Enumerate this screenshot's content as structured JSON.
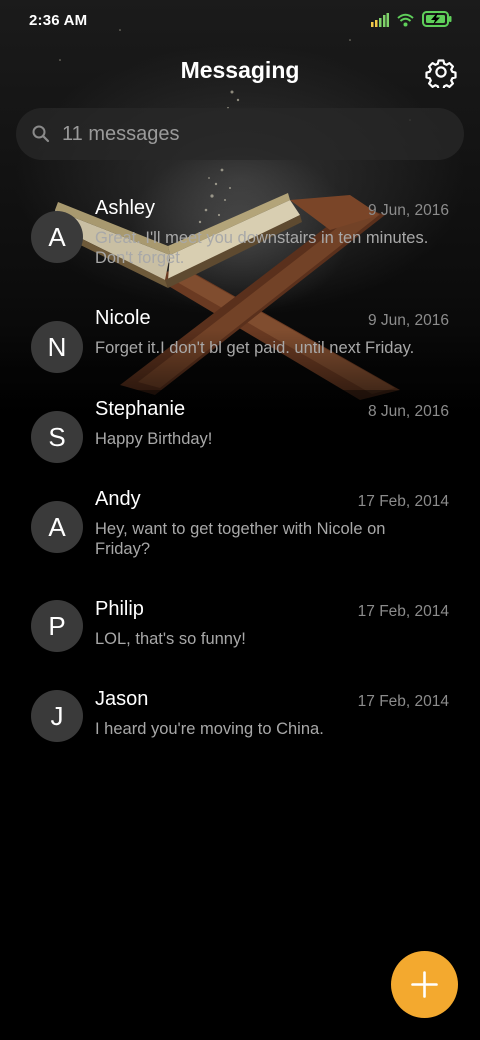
{
  "status_bar": {
    "time": "2:36 AM",
    "icons": [
      "signal-icon",
      "wifi-icon",
      "battery-charging-icon"
    ]
  },
  "header": {
    "title": "Messaging",
    "settings_icon": "gear-icon"
  },
  "search": {
    "placeholder": "11 messages",
    "icon": "search-icon"
  },
  "conversations": [
    {
      "initial": "A",
      "name": "Ashley",
      "date": "9 Jun, 2016",
      "snippet": "Great. I'll meet you downstairs in ten minutes. Don't forget."
    },
    {
      "initial": "N",
      "name": "Nicole",
      "date": "9 Jun, 2016",
      "snippet": "Forget it.I don't bl get paid. until next Friday."
    },
    {
      "initial": "S",
      "name": "Stephanie",
      "date": "8 Jun, 2016",
      "snippet": "Happy Birthday!"
    },
    {
      "initial": "A",
      "name": "Andy",
      "date": "17 Feb, 2014",
      "snippet": "Hey, want to get together with Nicole on Friday?"
    },
    {
      "initial": "P",
      "name": "Philip",
      "date": "17 Feb, 2014",
      "snippet": "LOL, that's so funny!"
    },
    {
      "initial": "J",
      "name": "Jason",
      "date": "17 Feb, 2014",
      "snippet": "I heard you're moving to China."
    }
  ],
  "fab": {
    "icon": "plus-icon"
  },
  "colors": {
    "background": "#000000",
    "accent": "#f3a92f",
    "avatar": "#3a3a3a",
    "snippet_text": "#a8a8a8",
    "date_text": "#8c8c8c"
  }
}
